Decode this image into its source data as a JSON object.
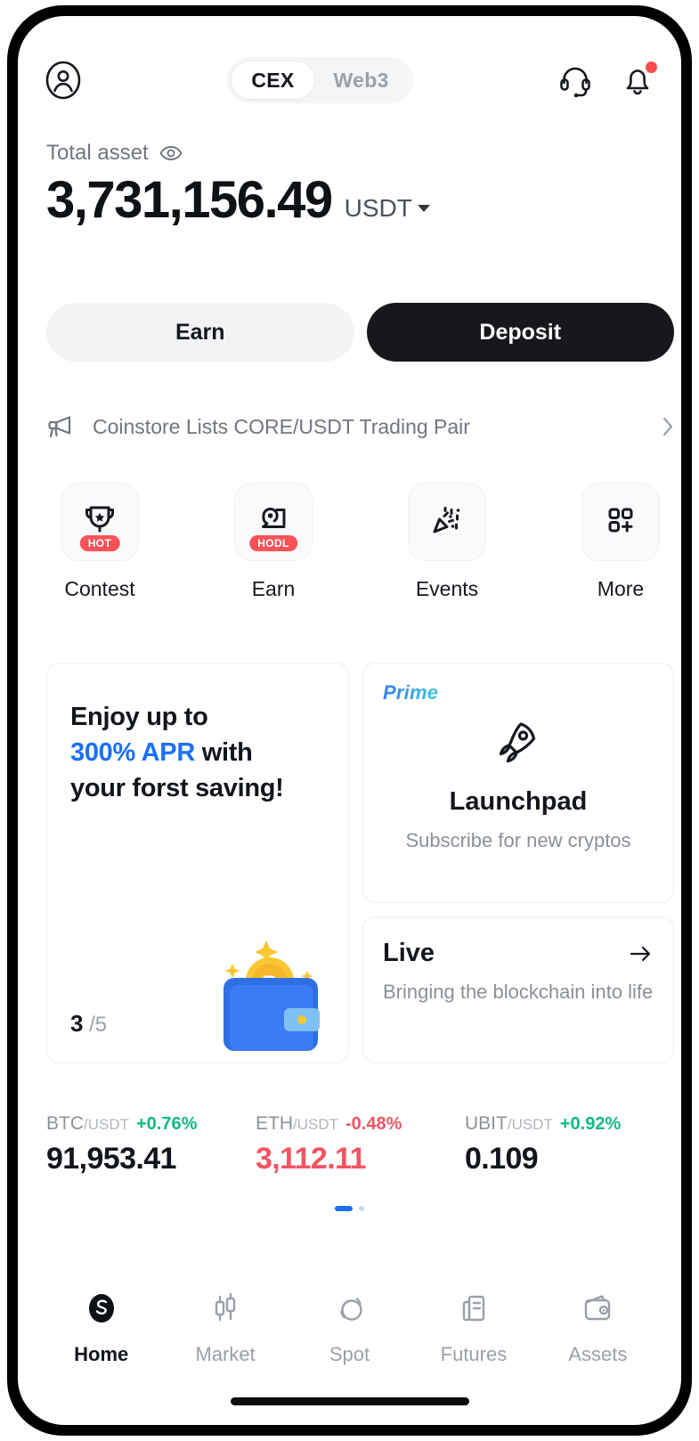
{
  "header": {
    "avatar_icon": "user-circle-icon",
    "segments": [
      {
        "label": "CEX",
        "active": true
      },
      {
        "label": "Web3",
        "active": false
      }
    ],
    "support_icon": "headset-icon",
    "notification_icon": "bell-icon",
    "has_notification_dot": true
  },
  "balance": {
    "label": "Total asset",
    "visibility_icon": "eye-icon",
    "amount": "3,731,156.49",
    "currency": "USDT",
    "currency_caret_icon": "chevron-down-icon"
  },
  "actions": {
    "earn_label": "Earn",
    "deposit_label": "Deposit"
  },
  "announcement": {
    "icon": "megaphone-icon",
    "text": "Coinstore Lists CORE/USDT Trading Pair",
    "chevron_icon": "chevron-right-icon"
  },
  "quick_actions": [
    {
      "label": "Contest",
      "icon": "trophy-icon",
      "badge": "HOT"
    },
    {
      "label": "Earn",
      "icon": "piggy-coin-icon",
      "badge": "HODL"
    },
    {
      "label": "Events",
      "icon": "confetti-icon",
      "badge": ""
    },
    {
      "label": "More",
      "icon": "grid-plus-icon",
      "badge": ""
    }
  ],
  "promo_card": {
    "line1": "Enjoy up to",
    "accent": "300% APR",
    "line2_tail": " with",
    "line3": "your forst saving!",
    "page_current": "3",
    "page_total": "/5",
    "art_icon": "wallet-bitcoin-icon"
  },
  "launchpad_card": {
    "tag": "Prime",
    "icon": "rocket-icon",
    "title": "Launchpad",
    "subtitle": "Subscribe for new cryptos"
  },
  "live_card": {
    "title": "Live",
    "arrow_icon": "arrow-right-icon",
    "subtitle": "Bringing the blockchain into life"
  },
  "tickers": [
    {
      "base": "BTC",
      "quote": "/USDT",
      "change": "+0.76%",
      "direction": "up",
      "price": "91,953.41",
      "price_color": "neutral"
    },
    {
      "base": "ETH",
      "quote": "/USDT",
      "change": "-0.48%",
      "direction": "down",
      "price": "3,112.11",
      "price_color": "down"
    },
    {
      "base": "UBIT",
      "quote": "/USDT",
      "change": "+0.92%",
      "direction": "up",
      "price": "0.109",
      "price_color": "neutral"
    }
  ],
  "carousel": {
    "total": 2,
    "active_index": 0
  },
  "bottom_nav": [
    {
      "label": "Home",
      "icon": "home-logo-icon",
      "active": true
    },
    {
      "label": "Market",
      "icon": "candlestick-icon",
      "active": false
    },
    {
      "label": "Spot",
      "icon": "swap-circles-icon",
      "active": false
    },
    {
      "label": "Futures",
      "icon": "document-icon",
      "active": false
    },
    {
      "label": "Assets",
      "icon": "wallet-icon",
      "active": false
    }
  ],
  "colors": {
    "accent_blue": "#1b6ff5",
    "up_green": "#11b981",
    "down_red": "#f05561",
    "badge_red": "#fa5258",
    "primary_black": "#16181c"
  }
}
